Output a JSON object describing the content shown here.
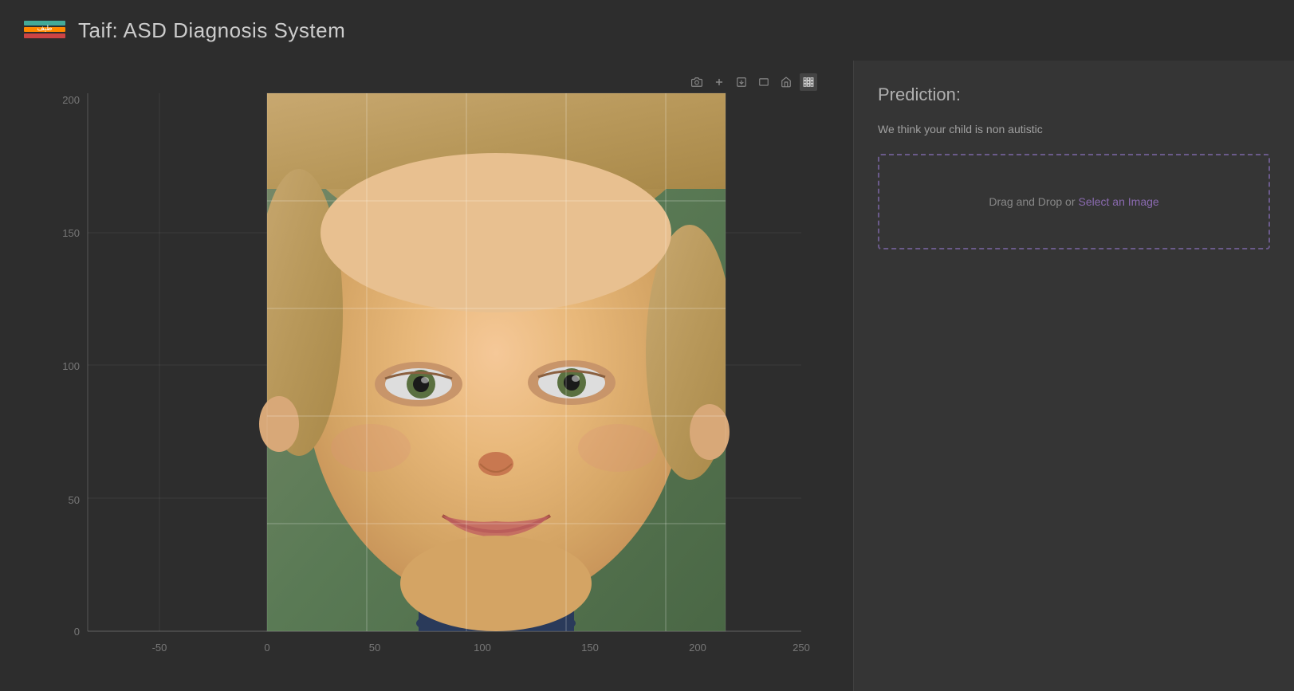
{
  "header": {
    "logo_text": "طيف",
    "title": "Taif: ASD Diagnosis System"
  },
  "toolbar": {
    "buttons": [
      {
        "id": "camera",
        "symbol": "📷",
        "active": false
      },
      {
        "id": "plus",
        "symbol": "+",
        "active": false
      },
      {
        "id": "download-image",
        "symbol": "⬛",
        "active": false
      },
      {
        "id": "download-svg",
        "symbol": "▬",
        "active": false
      },
      {
        "id": "home",
        "symbol": "⌂",
        "active": false
      },
      {
        "id": "settings",
        "symbol": "▦",
        "active": true
      }
    ]
  },
  "chart": {
    "y_axis": {
      "labels": [
        "0",
        "50",
        "100",
        "150",
        "200"
      ]
    },
    "x_axis": {
      "labels": [
        "-50",
        "0",
        "50",
        "100",
        "150",
        "200",
        "250"
      ]
    }
  },
  "prediction": {
    "title": "Prediction:",
    "result_text": "We think your child is non autistic"
  },
  "upload": {
    "drag_text": "Drag and Drop or ",
    "link_text": "Select an Image"
  }
}
